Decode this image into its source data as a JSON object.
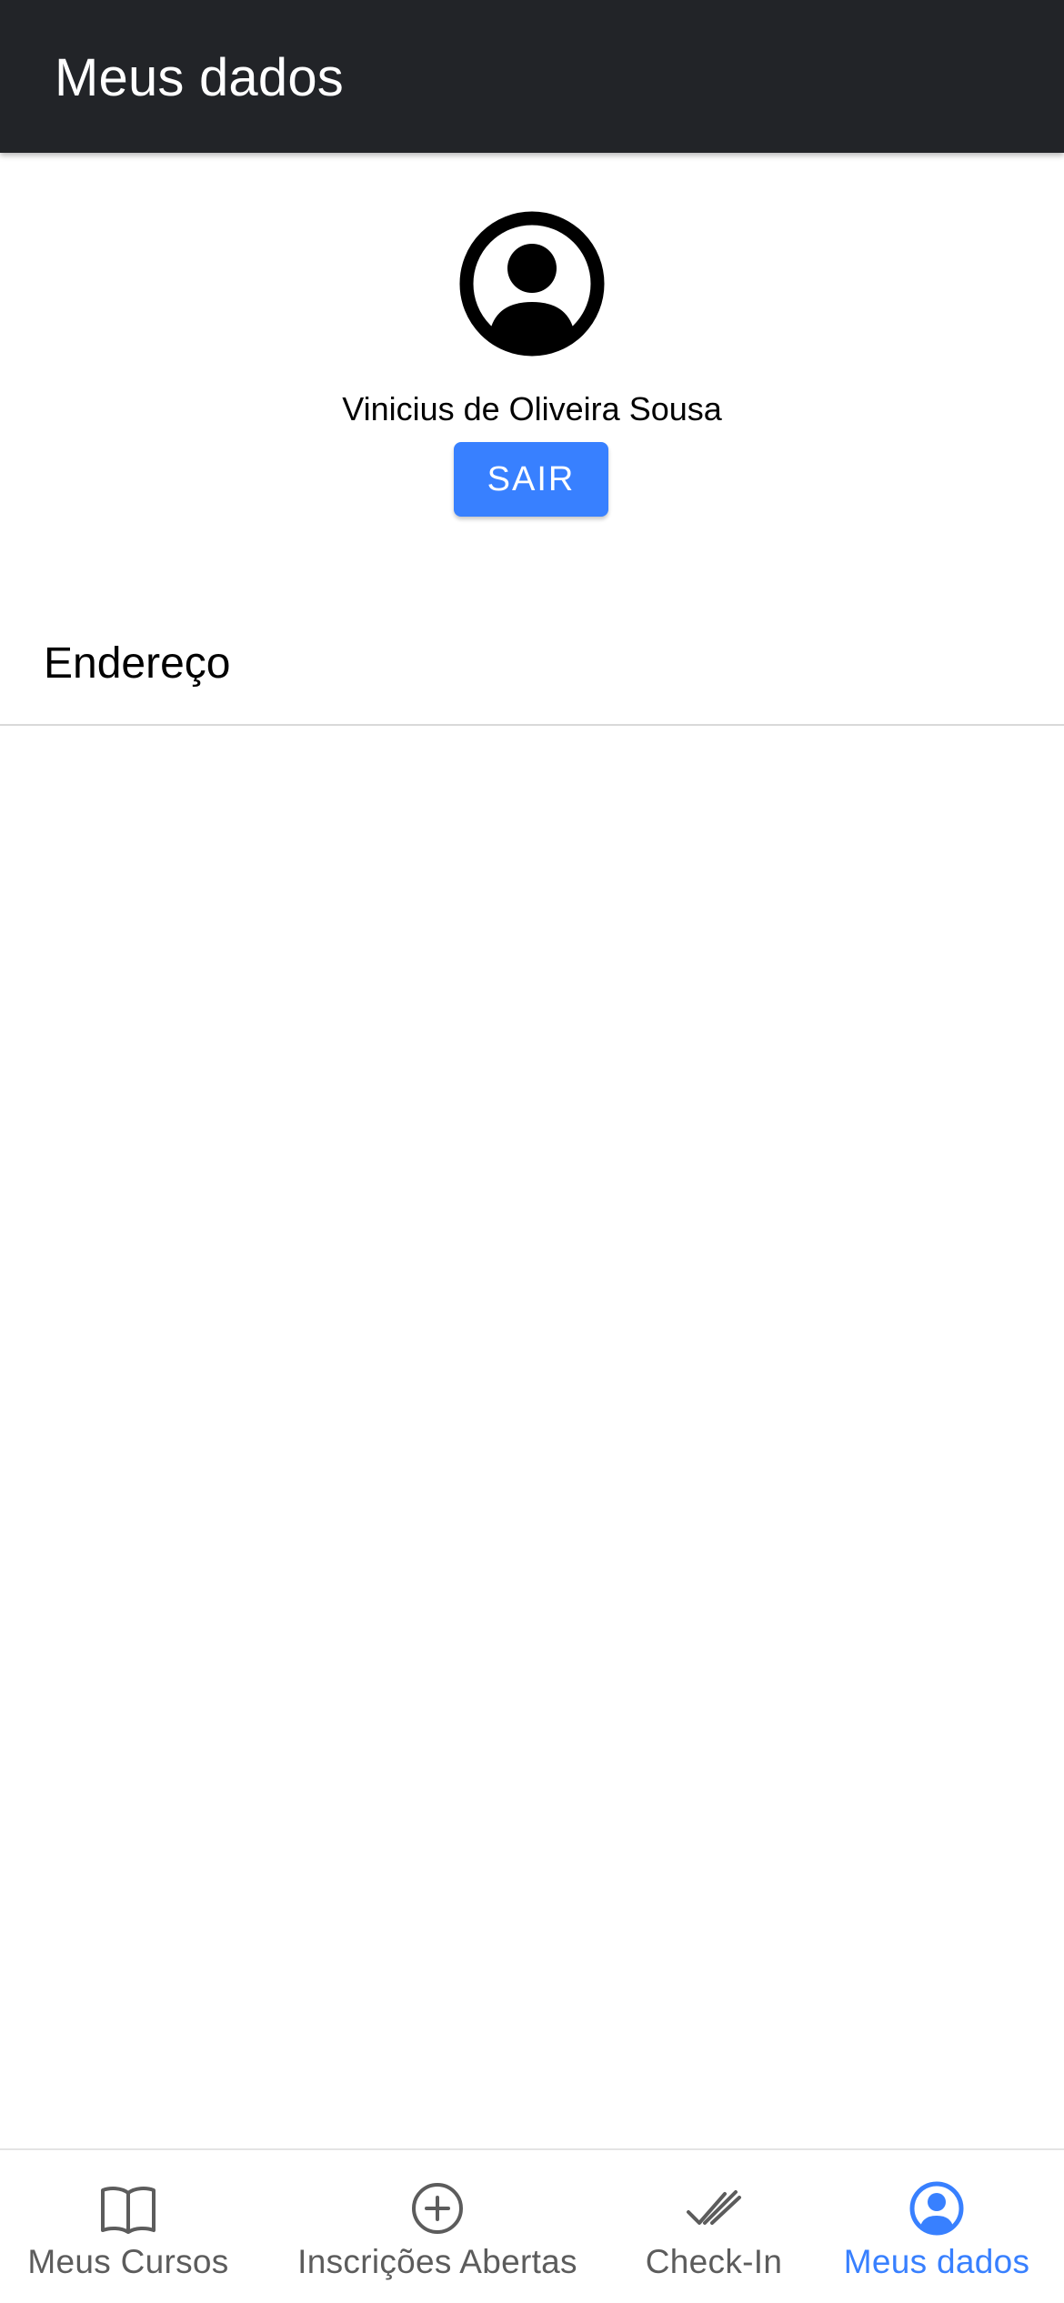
{
  "header": {
    "title": "Meus dados",
    "background": "#222428"
  },
  "profile": {
    "avatar_icon": "person-circle-icon",
    "name": "Vinicius de Oliveira Sousa",
    "logout_label": "SAIR"
  },
  "sections": [
    {
      "label": "Endereço"
    }
  ],
  "tabbar": {
    "tabs": [
      {
        "label": "Meus Cursos",
        "icon": "book-open-icon",
        "active": false
      },
      {
        "label": "Inscrições Abertas",
        "icon": "add-circle-icon",
        "active": false
      },
      {
        "label": "Check-In",
        "icon": "double-check-icon",
        "active": false
      },
      {
        "label": "Meus dados",
        "icon": "person-circle-icon",
        "active": true
      }
    ]
  },
  "colors": {
    "primary": "#3880ff",
    "inactive_tab": "#5c5c5c",
    "divider": "#d9d9d9"
  }
}
